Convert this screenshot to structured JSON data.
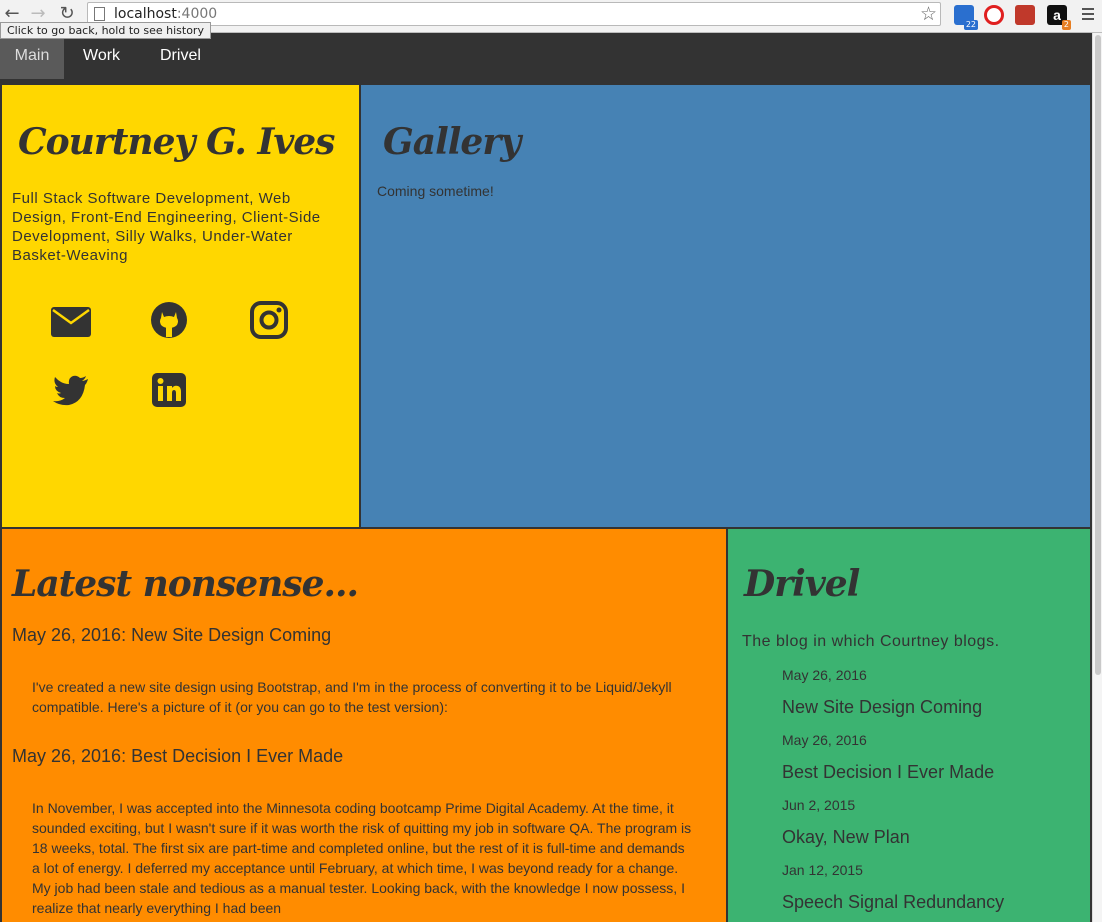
{
  "browser": {
    "url_host": "localhost",
    "url_port": ":4000",
    "tooltip": "Click to go back, hold to see history",
    "extensions": [
      {
        "name": "translate-extension",
        "badge": "22",
        "color": "#2a6fcf"
      },
      {
        "name": "opera-extension",
        "badge": "",
        "color": "#e02020"
      },
      {
        "name": "lastpass-extension",
        "badge": "",
        "color": "#c0392b"
      },
      {
        "name": "amazon-extension",
        "badge": "2",
        "color": "#111111"
      }
    ]
  },
  "nav": {
    "items": [
      "Main",
      "Work",
      "Drivel"
    ],
    "active": "Main"
  },
  "about": {
    "title": "Courtney G. Ives",
    "description": "Full Stack Software Development, Web Design, Front-End Engineering, Client-Side Development, Silly Walks, Under-Water Basket-Weaving",
    "social": [
      "envelope-icon",
      "github-icon",
      "instagram-icon",
      "twitter-icon",
      "linkedin-icon"
    ]
  },
  "gallery": {
    "title": "Gallery",
    "text": "Coming sometime!"
  },
  "latest": {
    "title": "Latest nonsense...",
    "posts": [
      {
        "title": "May 26, 2016: New Site Design Coming",
        "body": "I've created a new site design using Bootstrap, and I'm in the process of converting it to be Liquid/Jekyll compatible. Here's a picture of it (or you can go to the test version):"
      },
      {
        "title": "May 26, 2016: Best Decision I Ever Made",
        "body": "In November, I was accepted into the Minnesota coding bootcamp Prime Digital Academy. At the time, it sounded exciting, but I wasn't sure if it was worth the risk of quitting my job in software QA. The program is 18 weeks, total. The first six are part-time and completed online, but the rest of it is full-time and demands a lot of energy. I deferred my acceptance until February, at which time, I was beyond ready for a change. My job had been stale and tedious as a manual tester. Looking back, with the knowledge I now possess, I realize that nearly everything I had been"
      }
    ]
  },
  "drivel": {
    "title": "Drivel",
    "subtitle": "The blog in which Courtney blogs.",
    "entries": [
      {
        "date": "May 26, 2016",
        "title": "New Site Design Coming"
      },
      {
        "date": "May 26, 2016",
        "title": "Best Decision I Ever Made"
      },
      {
        "date": "Jun 2, 2015",
        "title": "Okay, New Plan"
      },
      {
        "date": "Jan 12, 2015",
        "title": "Speech Signal Redundancy"
      }
    ]
  }
}
